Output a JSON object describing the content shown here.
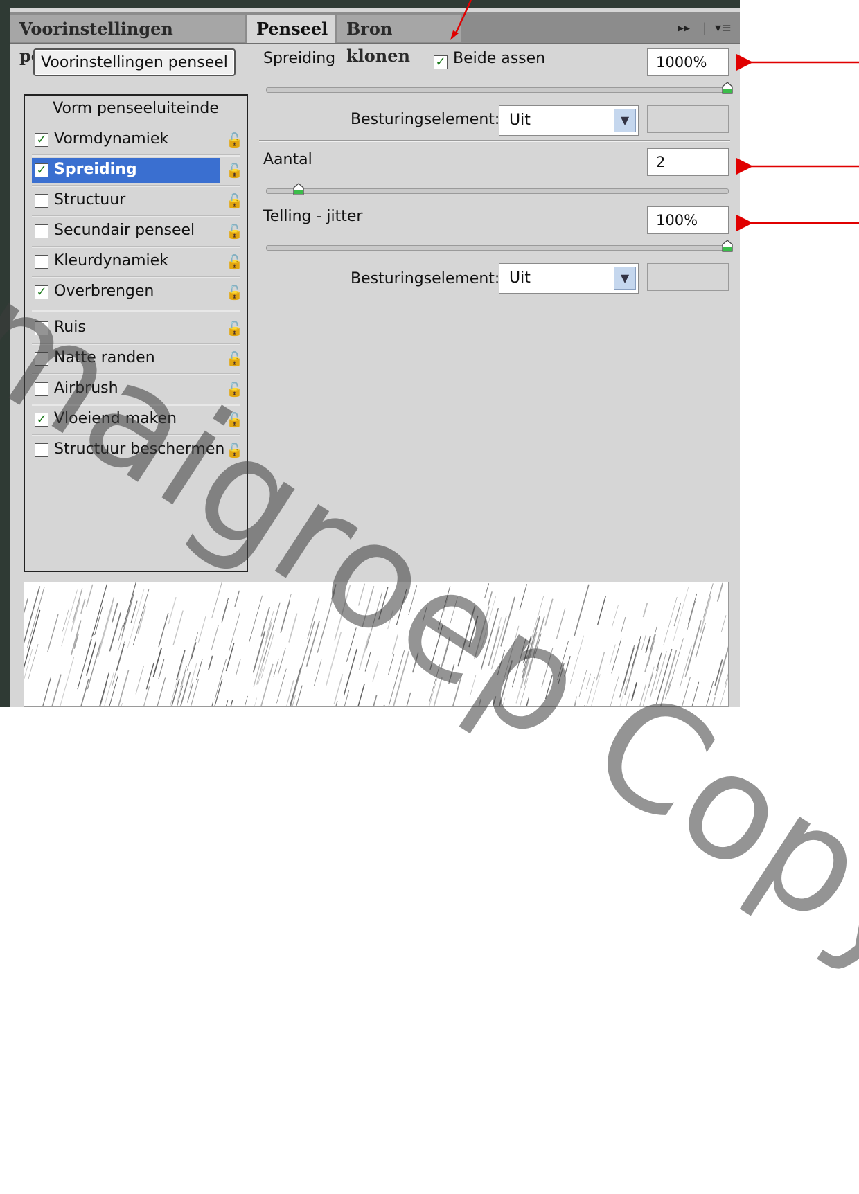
{
  "tabs": [
    {
      "label": "Voorinstellingen penseel"
    },
    {
      "label": "Penseel"
    },
    {
      "label": "Bron klonen"
    }
  ],
  "tab_controls": {
    "expand": "▸▸",
    "separator": "|",
    "menu": "▾≡"
  },
  "preset_button": "Voorinstellingen penseel",
  "list": {
    "header": "Vorm penseeluiteinde",
    "items": [
      {
        "label": "Vormdynamiek",
        "checked": true
      },
      {
        "label": "Spreiding",
        "checked": true,
        "selected": true
      },
      {
        "label": "Structuur",
        "checked": false
      },
      {
        "label": "Secundair penseel",
        "checked": false
      },
      {
        "label": "Kleurdynamiek",
        "checked": false
      },
      {
        "label": "Overbrengen",
        "checked": true
      },
      {
        "label": "Ruis",
        "checked": false
      },
      {
        "label": "Natte randen",
        "checked": false
      },
      {
        "label": "Airbrush",
        "checked": false
      },
      {
        "label": "Vloeiend maken",
        "checked": true
      },
      {
        "label": "Structuur beschermen",
        "checked": false
      }
    ],
    "check_glyph": "✓",
    "lock_glyph": "🔓"
  },
  "spreiding": {
    "label": "Spreiding",
    "both_axes_label": "Beide assen",
    "both_axes_checked": true,
    "value": "1000%",
    "slider_fraction": 1.0
  },
  "control1": {
    "label": "Besturingselement:",
    "value": "Uit"
  },
  "aantal": {
    "label": "Aantal",
    "value": "2",
    "slider_fraction": 0.07
  },
  "telling": {
    "label": "Telling - jitter",
    "value": "100%",
    "slider_fraction": 1.0
  },
  "control2": {
    "label": "Besturingselement:",
    "value": "Uit"
  },
  "dropdown_arrow": "▼",
  "watermark": "maigroep Copyright",
  "colors": {
    "selection": "#3a6fd0",
    "panel": "#d6d6d6",
    "annotation": "#e00000"
  }
}
